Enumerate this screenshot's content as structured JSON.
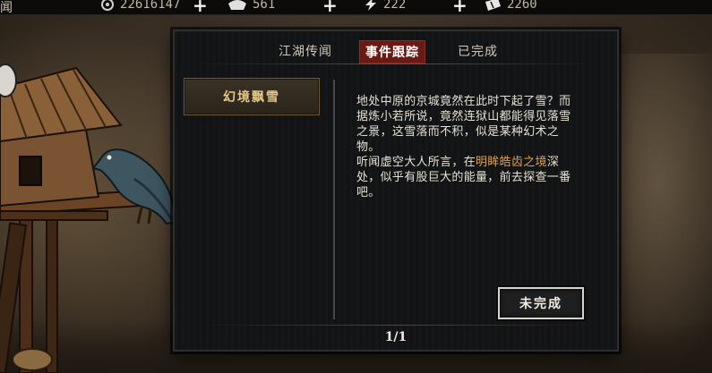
{
  "top_bar": {
    "left_text": "闻",
    "resources": [
      {
        "icon": "coin-icon",
        "value": "22616147"
      },
      {
        "icon": "ingot-icon",
        "value": "561"
      },
      {
        "icon": "lightning-icon",
        "value": "222"
      },
      {
        "icon": "ticket-icon",
        "value": "2260"
      }
    ],
    "plus": "+"
  },
  "tabs": [
    {
      "label": "江湖传闻",
      "active": false
    },
    {
      "label": "事件跟踪",
      "active": true
    },
    {
      "label": "已完成",
      "active": false
    }
  ],
  "events": [
    {
      "label": "幻境飘雪"
    }
  ],
  "description": {
    "para1": "地处中原的京城竟然在此时下起了雪？而据炼小若所说，竟然连狱山都能得见落雪之景，这雪落而不积，似是某种幻术之物。",
    "para2_before": "听闻虚空大人所言，在",
    "para2_highlight": "明眸皓齿之境",
    "para2_after": "深处，似乎有股巨大的能量，前去探查一番吧。"
  },
  "status_button": "未完成",
  "pager": "1/1",
  "colors": {
    "active_tab": "#6a1a14",
    "highlight": "#e3a34a",
    "event_label": "#e6c98a"
  }
}
